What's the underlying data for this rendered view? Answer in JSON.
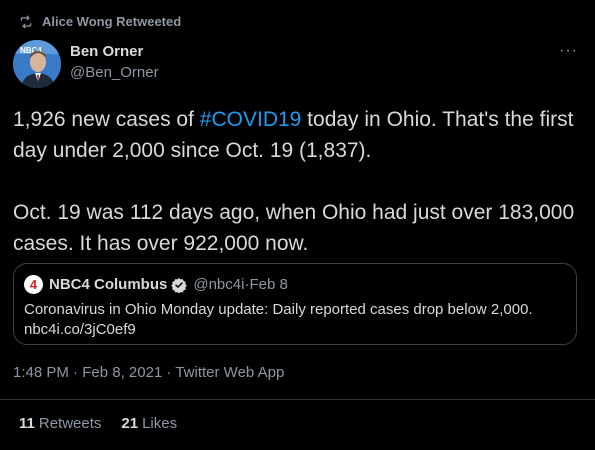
{
  "retweet": {
    "label": "Alice Wong Retweeted",
    "icon": "retweet-icon"
  },
  "author": {
    "name": "Ben Orner",
    "handle": "@Ben_Orner",
    "avatar_badge": "NBC4"
  },
  "more_icon": "more-icon",
  "tweet": {
    "line1_pre": "1,926 new cases of ",
    "hashtag": "#COVID19",
    "line1_post": " today in Ohio. That's the first day under 2,000 since Oct. 19 (1,837).",
    "paragraph2": "Oct. 19 was 112 days ago, when Ohio had just over 183,000 cases. It has over 922,000 now."
  },
  "quote": {
    "logo_text": "4",
    "name": "NBC4 Columbus",
    "handle": "@nbc4i",
    "separator": " · ",
    "date": "Feb 8",
    "body_line1": "Coronavirus in Ohio Monday update: Daily reported cases drop below 2,000.",
    "body_line2": "nbc4i.co/3jC0ef9"
  },
  "meta": {
    "time": "1:48 PM",
    "date": "Feb 8, 2021",
    "source": "Twitter Web App",
    "separator": " · "
  },
  "stats": {
    "retweets_count": "11",
    "retweets_label": "Retweets",
    "likes_count": "21",
    "likes_label": "Likes"
  },
  "colors": {
    "background": "#000000",
    "text": "#d9d9d9",
    "secondary": "#8b98a5",
    "accent": "#1d9bf0",
    "verified": "#d9d9d9"
  }
}
